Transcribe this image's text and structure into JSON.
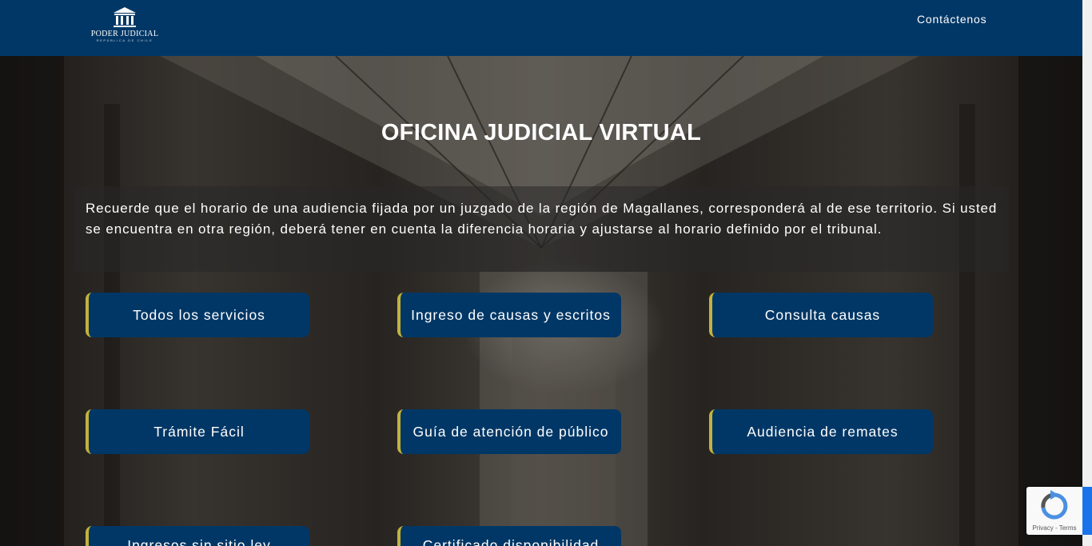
{
  "header": {
    "logo_text": "PODER JUDICIAL",
    "logo_subtext": "REPÚBLICA DE CHILE",
    "nav_contact": "Contáctenos"
  },
  "hero": {
    "title": "OFICINA JUDICIAL VIRTUAL",
    "notice": "Recuerde que el horario de una audiencia fijada por un juzgado de la región de Magallanes, corresponderá al de ese territorio. Si usted se encuentra en otra región, deberá tener en cuenta la diferencia horaria y ajustarse al horario definido por el tribunal."
  },
  "services": [
    {
      "label": "Todos los servicios"
    },
    {
      "label": "Ingreso de causas y escritos"
    },
    {
      "label": "Consulta causas"
    },
    {
      "label": "Trámite Fácil"
    },
    {
      "label": "Guía de atención de público"
    },
    {
      "label": "Audiencia de remates"
    },
    {
      "label": "Ingresos sin sitio ley"
    },
    {
      "label": "Certificado disponibilidad"
    }
  ],
  "recaptcha": {
    "links": "Privacy - Terms"
  },
  "colors": {
    "header_bg": "#013766",
    "button_bg": "#013766",
    "button_accent": "#c4b23c"
  }
}
